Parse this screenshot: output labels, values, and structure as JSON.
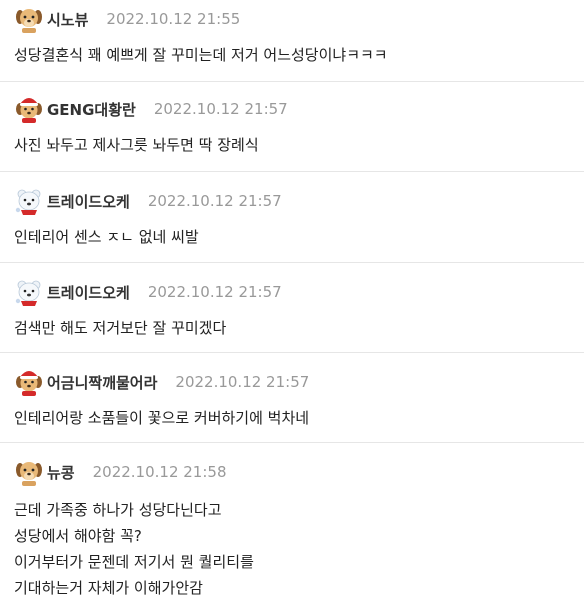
{
  "comments": [
    {
      "avatar_icon": "puppy-icon",
      "username": "시노뷰",
      "timestamp": "2022.10.12 21:55",
      "lines": [
        "성당결혼식 꽤 예쁘게 잘 꾸미는데 저거 어느성당이냐ㅋㅋㅋ"
      ]
    },
    {
      "avatar_icon": "santa-puppy-icon",
      "username": "GENG대황란",
      "timestamp": "2022.10.12 21:57",
      "lines": [
        "사진 놔두고 제사그릇 놔두면 딱 장례식"
      ]
    },
    {
      "avatar_icon": "polar-bear-icon",
      "username": "트레이드오케",
      "timestamp": "2022.10.12 21:57",
      "lines": [
        "인테리어 센스 ㅈㄴ 없네 씨발"
      ]
    },
    {
      "avatar_icon": "polar-bear-icon",
      "username": "트레이드오케",
      "timestamp": "2022.10.12 21:57",
      "lines": [
        "검색만 해도 저거보단 잘 꾸미겠다"
      ]
    },
    {
      "avatar_icon": "santa-puppy-icon",
      "username": "어금니짝깨물어라",
      "timestamp": "2022.10.12 21:57",
      "lines": [
        "인테리어랑 소품들이 꽃으로 커버하기에 벅차네"
      ]
    },
    {
      "avatar_icon": "puppy-icon",
      "username": "뉴콩",
      "timestamp": "2022.10.12 21:58",
      "lines": [
        "근데 가족중 하나가 성당다닌다고",
        "성당에서 해야함 꼭?",
        "이거부터가 문젠데 저기서 뭔 퀄리티를",
        "기대하는거 자체가 이해가안감"
      ]
    }
  ],
  "colors": {
    "username": "#333333",
    "timestamp": "#999999",
    "body_text": "#222222",
    "divider": "#e6e6e6"
  }
}
